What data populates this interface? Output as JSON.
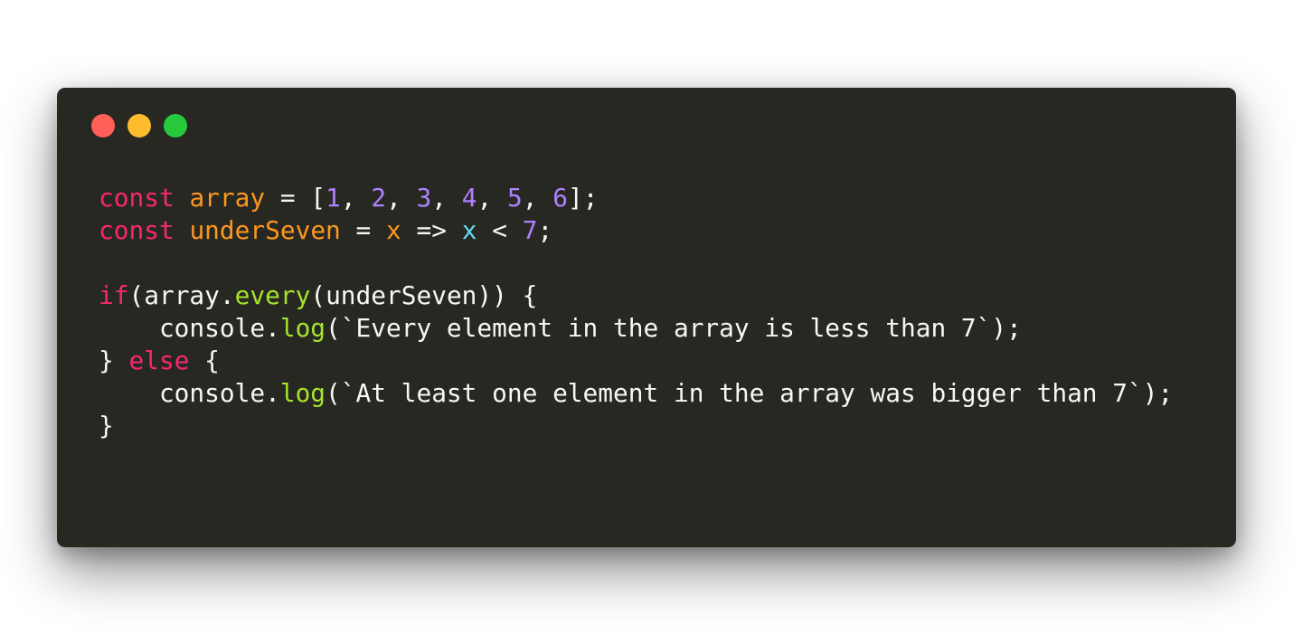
{
  "window": {
    "controls": [
      {
        "name": "close",
        "color": "#ff5f56"
      },
      {
        "name": "minimize",
        "color": "#ffbd2e"
      },
      {
        "name": "maximize",
        "color": "#27c93f"
      }
    ]
  },
  "colors": {
    "background": "#272822",
    "text": "#f8f8f2",
    "keyword": "#f92672",
    "identifier": "#fd971f",
    "number": "#ae81ff",
    "function": "#a6e22e",
    "parameter": "#66d9ef"
  },
  "code": {
    "language": "javascript",
    "lines": [
      [
        {
          "text": "const",
          "type": "keyword"
        },
        {
          "text": " ",
          "type": "plain"
        },
        {
          "text": "array",
          "type": "identifier"
        },
        {
          "text": " = [",
          "type": "plain"
        },
        {
          "text": "1",
          "type": "number"
        },
        {
          "text": ", ",
          "type": "plain"
        },
        {
          "text": "2",
          "type": "number"
        },
        {
          "text": ", ",
          "type": "plain"
        },
        {
          "text": "3",
          "type": "number"
        },
        {
          "text": ", ",
          "type": "plain"
        },
        {
          "text": "4",
          "type": "number"
        },
        {
          "text": ", ",
          "type": "plain"
        },
        {
          "text": "5",
          "type": "number"
        },
        {
          "text": ", ",
          "type": "plain"
        },
        {
          "text": "6",
          "type": "number"
        },
        {
          "text": "];",
          "type": "plain"
        }
      ],
      [
        {
          "text": "const",
          "type": "keyword"
        },
        {
          "text": " ",
          "type": "plain"
        },
        {
          "text": "underSeven",
          "type": "identifier"
        },
        {
          "text": " = ",
          "type": "plain"
        },
        {
          "text": "x",
          "type": "identifier"
        },
        {
          "text": " => ",
          "type": "plain"
        },
        {
          "text": "x",
          "type": "parameter"
        },
        {
          "text": " < ",
          "type": "plain"
        },
        {
          "text": "7",
          "type": "number"
        },
        {
          "text": ";",
          "type": "plain"
        }
      ],
      [],
      [
        {
          "text": "if",
          "type": "keyword"
        },
        {
          "text": "(array.",
          "type": "plain"
        },
        {
          "text": "every",
          "type": "function"
        },
        {
          "text": "(underSeven)) {",
          "type": "plain"
        }
      ],
      [
        {
          "text": "    console.",
          "type": "plain"
        },
        {
          "text": "log",
          "type": "function"
        },
        {
          "text": "(`Every element in the array is less than 7`);",
          "type": "plain"
        }
      ],
      [
        {
          "text": "} ",
          "type": "plain"
        },
        {
          "text": "else",
          "type": "keyword"
        },
        {
          "text": " {",
          "type": "plain"
        }
      ],
      [
        {
          "text": "    console.",
          "type": "plain"
        },
        {
          "text": "log",
          "type": "function"
        },
        {
          "text": "(`At least one element in the array was bigger than 7`);",
          "type": "plain"
        }
      ],
      [
        {
          "text": "}",
          "type": "plain"
        }
      ]
    ]
  }
}
